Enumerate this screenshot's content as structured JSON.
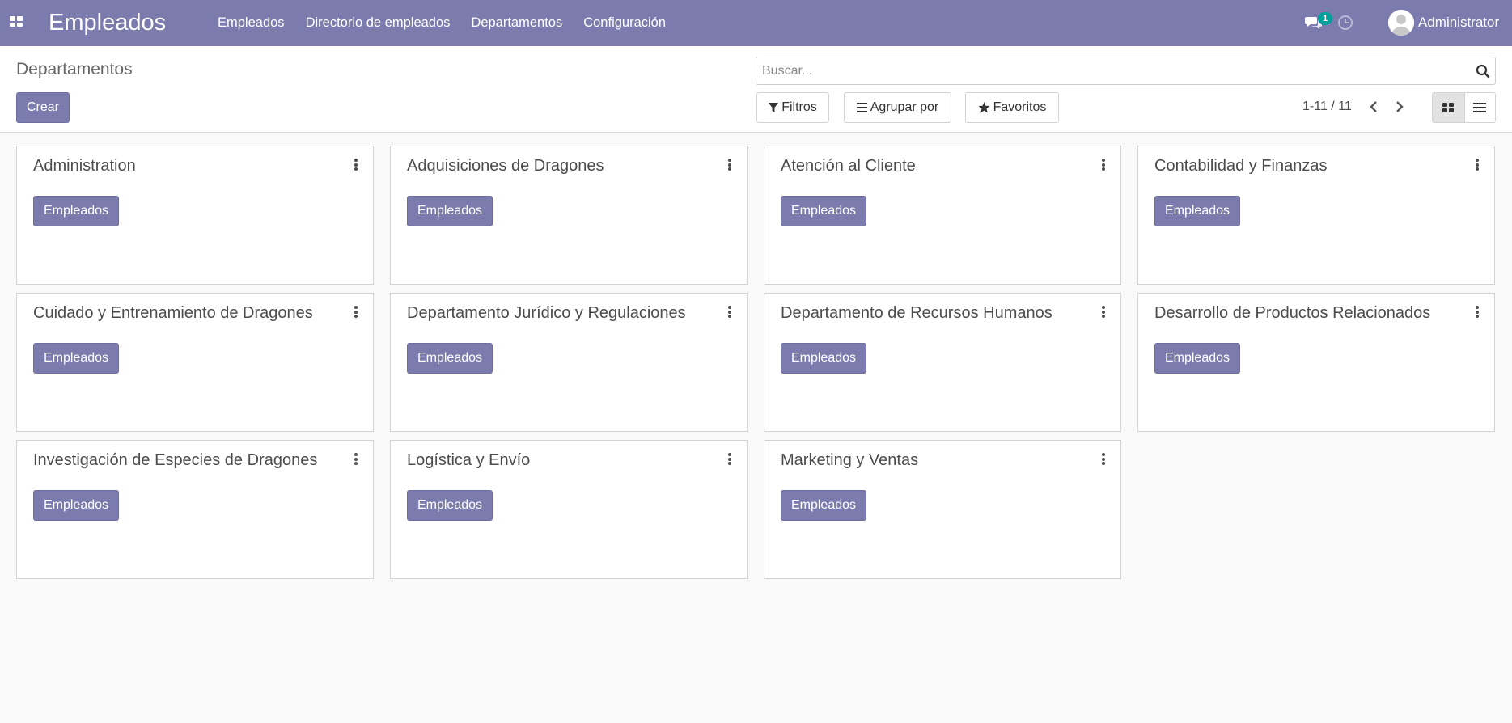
{
  "navbar": {
    "app_title": "Empleados",
    "menu": [
      "Empleados",
      "Directorio de empleados",
      "Departamentos",
      "Configuración"
    ],
    "chat_badge": "1",
    "user_name": "Administrator",
    "color": "#7c7bad",
    "badge_color": "#00a09d"
  },
  "control_panel": {
    "breadcrumb": "Departamentos",
    "create_label": "Crear",
    "search_placeholder": "Buscar...",
    "filters_label": "Filtros",
    "group_by_label": "Agrupar por",
    "favorites_label": "Favoritos",
    "pager": "1-11 / 11",
    "active_view": "kanban"
  },
  "departments": [
    {
      "name": "Administration",
      "button": "Empleados"
    },
    {
      "name": "Adquisiciones de Dragones",
      "button": "Empleados"
    },
    {
      "name": "Atención al Cliente",
      "button": "Empleados"
    },
    {
      "name": "Contabilidad y Finanzas",
      "button": "Empleados"
    },
    {
      "name": "Cuidado y Entrenamiento de Dragones",
      "button": "Empleados"
    },
    {
      "name": "Departamento Jurídico y Regulaciones",
      "button": "Empleados"
    },
    {
      "name": "Departamento de Recursos Humanos",
      "button": "Empleados"
    },
    {
      "name": "Desarrollo de Productos Relacionados",
      "button": "Empleados"
    },
    {
      "name": "Investigación de Especies de Dragones",
      "button": "Empleados"
    },
    {
      "name": "Logística y Envío",
      "button": "Empleados"
    },
    {
      "name": "Marketing y Ventas",
      "button": "Empleados"
    }
  ]
}
